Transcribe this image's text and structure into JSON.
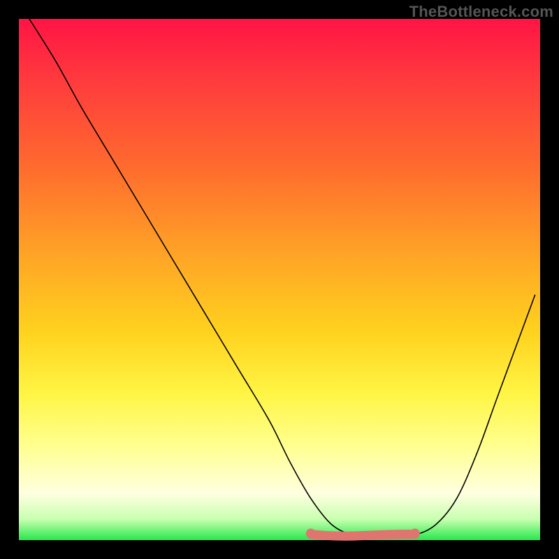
{
  "watermark": "TheBottleneck.com",
  "chart_data": {
    "type": "line",
    "title": "",
    "xlabel": "",
    "ylabel": "",
    "xlim": [
      0,
      100
    ],
    "ylim": [
      0,
      100
    ],
    "series": [
      {
        "name": "bottleneck-curve",
        "x": [
          2,
          7,
          12,
          18,
          24,
          30,
          36,
          42,
          48,
          52,
          56,
          60,
          64,
          68,
          72,
          76,
          80,
          84,
          88,
          92,
          99
        ],
        "values": [
          100,
          92,
          83,
          73,
          63,
          53,
          43,
          33,
          23,
          15,
          8,
          3,
          1,
          0.5,
          0.5,
          1,
          3,
          8,
          17,
          28,
          47
        ]
      }
    ],
    "highlight": {
      "name": "flat-minimum-segment",
      "x_start": 56,
      "x_end": 76,
      "y": 1,
      "color": "#e0746e"
    },
    "gradient_stops": [
      {
        "pos": 0,
        "color": "#ff1444"
      },
      {
        "pos": 12,
        "color": "#ff3b3d"
      },
      {
        "pos": 28,
        "color": "#ff6a2e"
      },
      {
        "pos": 45,
        "color": "#ffa326"
      },
      {
        "pos": 60,
        "color": "#ffd21e"
      },
      {
        "pos": 72,
        "color": "#fff545"
      },
      {
        "pos": 82,
        "color": "#ffff90"
      },
      {
        "pos": 91,
        "color": "#ffffe0"
      },
      {
        "pos": 96,
        "color": "#c9ffb0"
      },
      {
        "pos": 100,
        "color": "#26e84a"
      }
    ]
  }
}
